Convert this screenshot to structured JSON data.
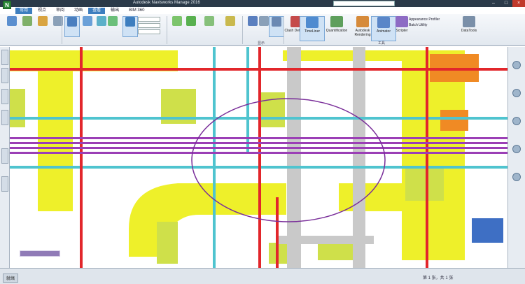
{
  "app": {
    "logo": "N",
    "title": "Autodesk Navisworks Manage 2016"
  },
  "menu": {
    "tabs": [
      {
        "label": "常用"
      },
      {
        "label": "视点"
      },
      {
        "label": "审阅"
      },
      {
        "label": "动画"
      },
      {
        "label": "查看"
      },
      {
        "label": "输出"
      },
      {
        "label": "BIM 360"
      }
    ]
  },
  "ribbon": {
    "clash_detective": "Clash Detective",
    "timeliner": "TimeLiner",
    "quantification": "Quantification",
    "autodesk_rendering": "Autodesk Rendering",
    "animator": "Animator",
    "scripter": "Scripter",
    "appearance_profiler": "Appearance Profiler",
    "batch_utility": "Batch Utility",
    "datatools": "DataTools",
    "panel_tools": "工具",
    "panel_display": "显示"
  },
  "status": {
    "ready": "就绪",
    "page": "第 1 张，共 1 张"
  },
  "colors": {
    "duct_yellow": "#eef02a",
    "pipe_red": "#e2262b",
    "pipe_purple": "#9b3fb6",
    "pipe_cyan": "#4fc4cf",
    "beam_gray": "#c9c9c9",
    "orange_equipment": "#f08a24",
    "blue_equipment": "#3e6fc4",
    "green_equipment": "#cfe04a",
    "selection_ellipse": "#7a2f9a"
  }
}
